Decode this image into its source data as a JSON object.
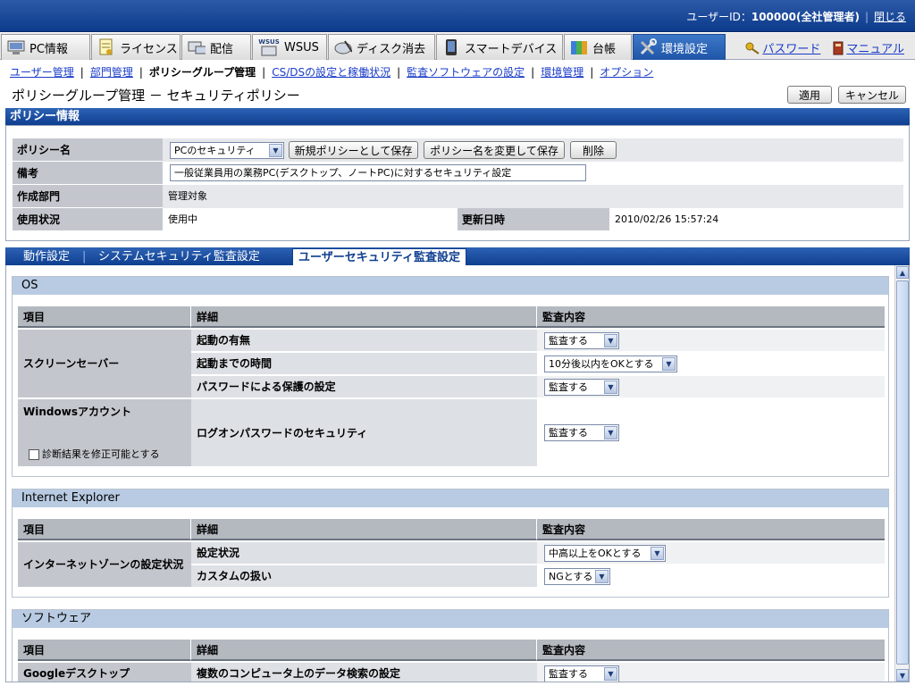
{
  "topbar": {
    "user_label": "ユーザーID：",
    "user_value": "100000(全社管理者)",
    "close": "閉じる"
  },
  "main_tabs": [
    {
      "label": "PC情報",
      "icon": "pc-icon"
    },
    {
      "label": "ライセンス",
      "icon": "license-icon"
    },
    {
      "label": "配信",
      "icon": "distribution-icon"
    },
    {
      "label": "WSUS",
      "icon": "wsus-icon",
      "badge": "WSUS"
    },
    {
      "label": "ディスク消去",
      "icon": "disk-erase-icon"
    },
    {
      "label": "スマートデバイス",
      "icon": "smart-device-icon"
    },
    {
      "label": "台帳",
      "icon": "ledger-icon"
    },
    {
      "label": "環境設定",
      "icon": "settings-tools-icon"
    }
  ],
  "right_links": {
    "password": "パスワード",
    "manual": "マニュアル"
  },
  "subnav": {
    "items": [
      "ユーザー管理",
      "部門管理",
      "ポリシーグループ管理",
      "CS/DSの設定と稼働状況",
      "監査ソフトウェアの設定",
      "環境管理",
      "オプション"
    ]
  },
  "page": {
    "title": "ポリシーグループ管理 － セキュリティポリシー",
    "apply": "適用",
    "cancel": "キャンセル"
  },
  "policy_info": {
    "header": "ポリシー情報",
    "name_label": "ポリシー名",
    "name_value": "PCのセキュリティ",
    "save_new": "新規ポリシーとして保存",
    "rename_save": "ポリシー名を変更して保存",
    "delete": "削除",
    "note_label": "備考",
    "note_value": "一般従業員用の業務PC(デスクトップ、ノートPC)に対するセキュリティ設定",
    "dept_label": "作成部門",
    "dept_value": "管理対象",
    "status_label": "使用状況",
    "status_value": "使用中",
    "updated_label": "更新日時",
    "updated_value": "2010/02/26 15:57:24"
  },
  "sub_tabs": [
    "動作設定",
    "システムセキュリティ監査設定",
    "ユーザーセキュリティ監査設定"
  ],
  "columns": {
    "item": "項目",
    "detail": "詳細",
    "audit": "監査内容"
  },
  "sections": {
    "os": {
      "title": "OS",
      "screensaver": "スクリーンセーバー",
      "ss_rows": [
        {
          "detail": "起動の有無",
          "value": "監査する"
        },
        {
          "detail": "起動までの時間",
          "value": "10分後以内をOKとする"
        },
        {
          "detail": "パスワードによる保護の設定",
          "value": "監査する"
        }
      ],
      "windows_account": "Windowsアカウント",
      "checkbox_label": "診断結果を修正可能とする",
      "logon_detail": "ログオンパスワードのセキュリティ",
      "logon_value": "監査する"
    },
    "ie": {
      "title": "Internet Explorer",
      "zone": "インターネットゾーンの設定状況",
      "rows": [
        {
          "detail": "設定状況",
          "value": "中高以上をOKとする"
        },
        {
          "detail": "カスタムの扱い",
          "value": "NGとする"
        }
      ]
    },
    "software": {
      "title": "ソフトウェア",
      "item": "Googleデスクトップ",
      "detail": "複数のコンピュータ上のデータ検索の設定",
      "value": "監査する"
    }
  }
}
